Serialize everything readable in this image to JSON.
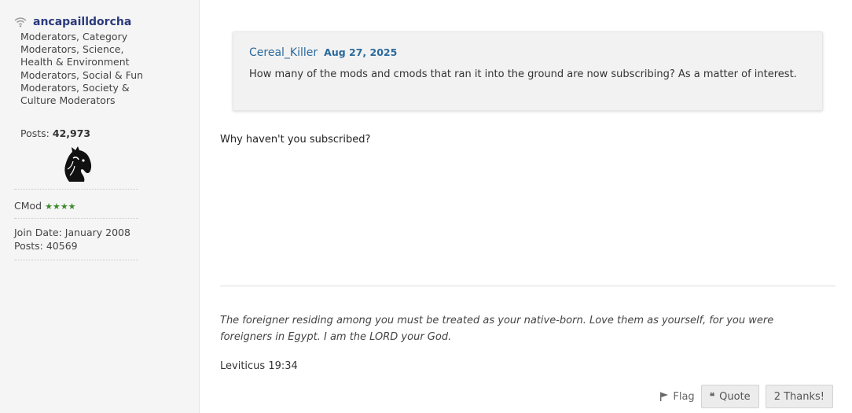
{
  "sidebar": {
    "username": "ancapailldorcha",
    "usertitle": "Moderators, Category Moderators, Science, Health & Environment Moderators, Social & Fun Moderators, Society & Culture Moderators",
    "posts_label": "Posts:",
    "posts_value": "42,973",
    "rank_label": "CMod",
    "rank_stars": "★★★★",
    "join_date": "Join Date: January 2008",
    "posts_line": "Posts: 40569"
  },
  "quote": {
    "author": "Cereal_Killer",
    "date": "Aug 27, 2025",
    "text": "How many of the mods and cmods that ran it into the ground are now subscribing? As a matter of interest."
  },
  "post": {
    "body": "Why haven't you subscribed?"
  },
  "signature": {
    "verse": "The foreigner residing among you must be treated as your native-born. Love them as yourself, for you were foreigners in Egypt. I am the LORD your God.",
    "reference": "Leviticus 19:34"
  },
  "actions": {
    "flag_label": "Flag",
    "quote_label": "Quote",
    "thanks_label": "2 Thanks!"
  },
  "icons": {
    "online": "wifi-icon",
    "avatar": "horse-head-icon",
    "flag": "flag-icon",
    "quote": "quote-icon"
  },
  "colors": {
    "username": "#2a3a7c",
    "link": "#2b6a9c",
    "stars": "#3b8a28"
  }
}
